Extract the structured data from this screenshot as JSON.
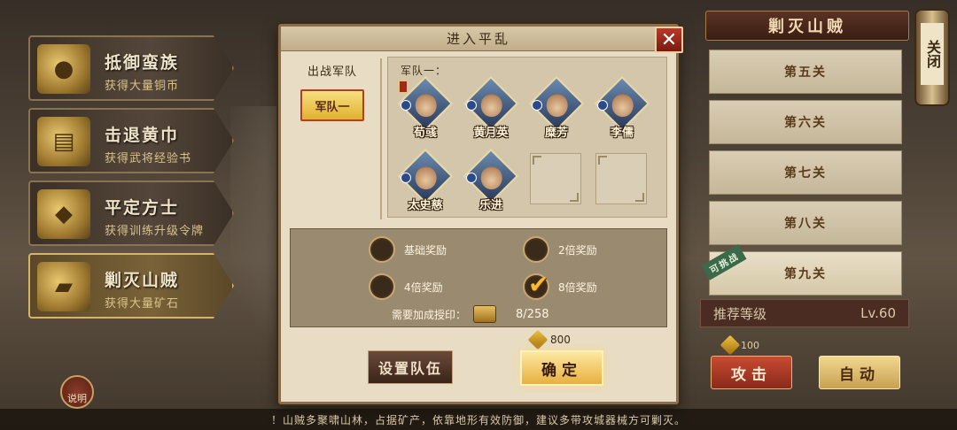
{
  "left_menu": [
    {
      "title": "抵御蛮族",
      "subtitle": "获得大量铜币",
      "icon": "coin-pile-icon"
    },
    {
      "title": "击退黄巾",
      "subtitle": "获得武将经验书",
      "icon": "book-icon"
    },
    {
      "title": "平定方士",
      "subtitle": "获得训练升级令牌",
      "icon": "token-icon"
    },
    {
      "title": "剿灭山贼",
      "subtitle": "获得大量矿石",
      "icon": "ore-icon"
    }
  ],
  "help_label": "说明",
  "right_panel": {
    "title": "剿灭山贼",
    "stages": [
      "第五关",
      "第六关",
      "第七关",
      "第八关",
      "第九关"
    ],
    "challengeable_tag": "可挑战",
    "recommended_label": "推荐等级",
    "recommended_level": "Lv.60",
    "cost": "100",
    "attack_label": "攻击",
    "auto_label": "自动"
  },
  "close_scroll_label": "关闭",
  "modal": {
    "title": "进入平乱",
    "close_icon": "✕",
    "army_column_label": "出战军队",
    "army_tab": "军队一",
    "team_label": "军队一：",
    "heroes": [
      {
        "name": "荀彧",
        "portrait": "hero-xunyu-portrait"
      },
      {
        "name": "黄月英",
        "portrait": "hero-huangyueying-portrait"
      },
      {
        "name": "糜芳",
        "portrait": "hero-mifang-portrait"
      },
      {
        "name": "李儒",
        "portrait": "hero-liru-portrait"
      },
      {
        "name": "太史慈",
        "portrait": "hero-taishici-portrait"
      },
      {
        "name": "乐进",
        "portrait": "hero-lejin-portrait"
      }
    ],
    "rewards": {
      "basic": "基础奖励",
      "double": "2倍奖励",
      "quad": "4倍奖励",
      "octuple": "8倍奖励",
      "selected": "8倍奖励"
    },
    "need_label": "需要加成授印：",
    "need_count": "8/258",
    "cost": "800",
    "set_team_label": "设置队伍",
    "confirm_label": "确定"
  },
  "tip": "！山贼多聚啸山林，占据矿产，依靠地形有效防御，建议多带攻城器械方可剿灭。",
  "colors": {
    "accent_gold": "#e8b040",
    "close_red": "#b83a2a",
    "panel_bg": "#e8dcc4"
  }
}
